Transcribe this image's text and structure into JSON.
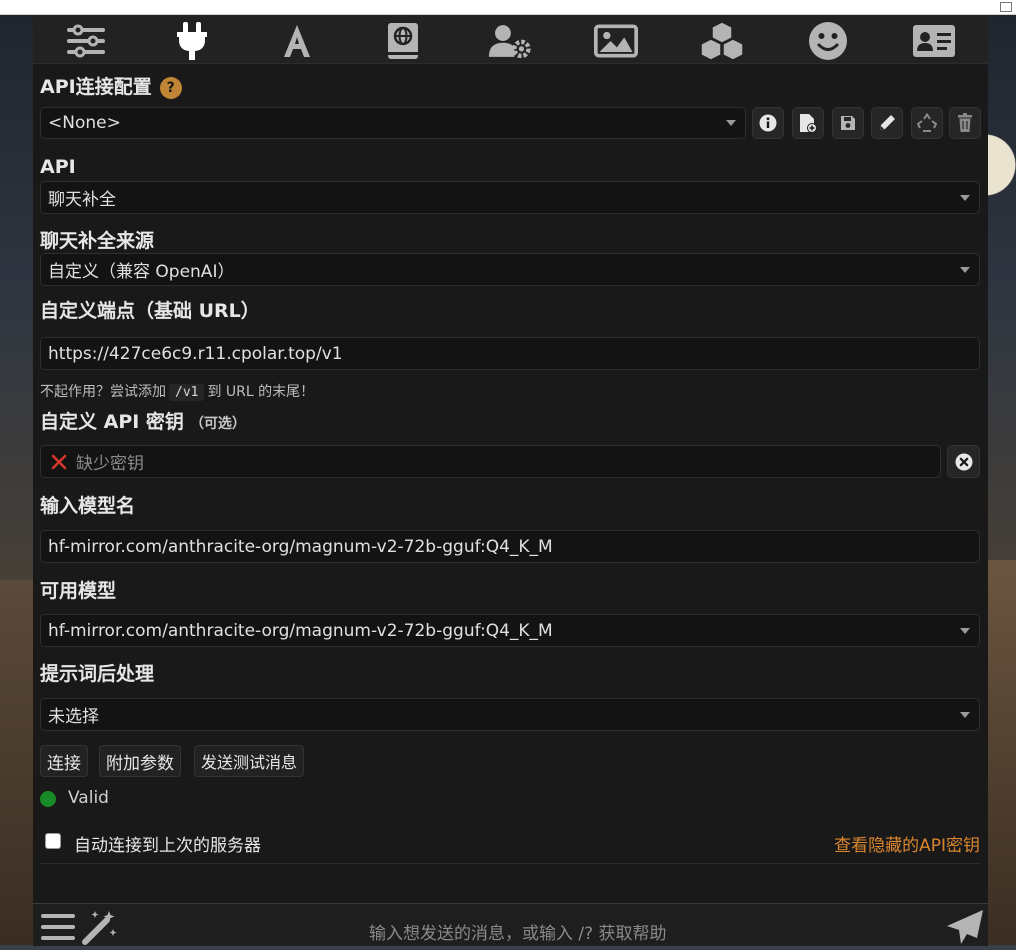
{
  "topbar": {
    "icons": [
      "sliders-icon",
      "plug-icon",
      "font-icon",
      "book-globe-icon",
      "user-gear-icon",
      "image-icon",
      "cubes-icon",
      "smiley-icon",
      "id-card-icon"
    ],
    "active_index": 1,
    "icon_color": "#b4b4b4",
    "active_color": "#ffffff"
  },
  "connection_profile": {
    "label": "API连接配置",
    "help": "?",
    "selected": "<None>",
    "action_icons": [
      "info-icon",
      "new-file-icon",
      "save-icon",
      "pencil-icon",
      "recycle-icon",
      "trash-icon"
    ]
  },
  "api": {
    "label": "API",
    "selected": "聊天补全"
  },
  "source": {
    "label": "聊天补全来源",
    "selected": "自定义（兼容 OpenAI）"
  },
  "endpoint": {
    "label": "自定义端点（基础 URL）",
    "value": "https://427ce6c9.r11.cpolar.top/v1",
    "hint_before": "不起作用？尝试添加",
    "hint_code": "/v1",
    "hint_after": "到 URL 的末尾！"
  },
  "api_key": {
    "label": "自定义 API 密钥",
    "optional": "（可选）",
    "placeholder": "缺少密钥"
  },
  "model_name": {
    "label": "输入模型名",
    "value": "hf-mirror.com/anthracite-org/magnum-v2-72b-gguf:Q4_K_M"
  },
  "available_models": {
    "label": "可用模型",
    "selected": "hf-mirror.com/anthracite-org/magnum-v2-72b-gguf:Q4_K_M"
  },
  "post_processing": {
    "label": "提示词后处理",
    "selected": "未选择"
  },
  "buttons": {
    "connect": "连接",
    "extra_params": "附加参数",
    "send_test": "发送测试消息"
  },
  "status": {
    "text": "Valid",
    "color": "#198a2a"
  },
  "auto_connect": {
    "label": "自动连接到上次的服务器",
    "checked": false
  },
  "view_hidden_keys": "查看隐藏的API密钥",
  "chat": {
    "placeholder": "输入想发送的消息，或输入 /? 获取帮助"
  },
  "colors": {
    "panel_bg": "#191919",
    "accent_orange": "#d9852f",
    "help_badge": "#c08636"
  }
}
